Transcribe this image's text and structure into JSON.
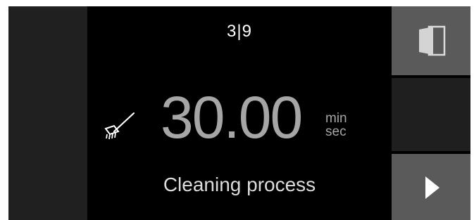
{
  "display": {
    "step_indicator": "3|9",
    "time_value": "30.00",
    "time_unit_top": "min",
    "time_unit_bottom": "sec",
    "process_label": "Cleaning process"
  },
  "icons": {
    "program_icon": "brush-icon",
    "door_button_icon": "door-icon",
    "next_button_icon": "play-arrow-icon"
  },
  "colors": {
    "background": "#000000",
    "panel": "#202020",
    "button": "#5a5a5a",
    "time_text": "#a6a6a6"
  }
}
